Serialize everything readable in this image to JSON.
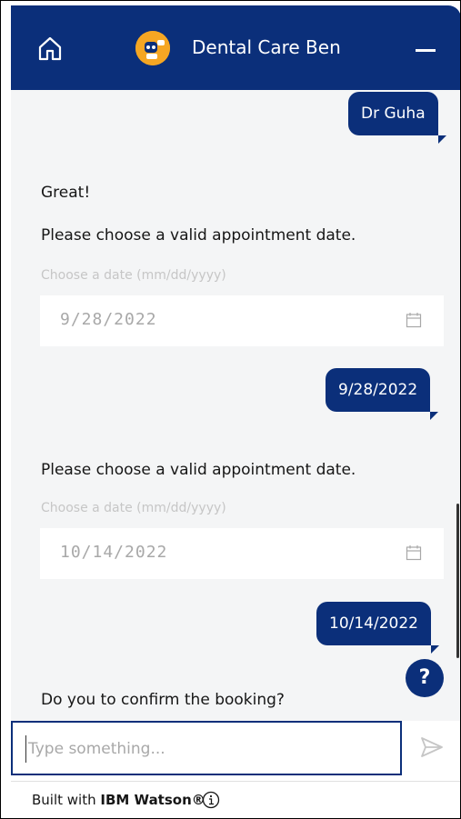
{
  "header": {
    "title": "Dental Care Ben"
  },
  "messages": {
    "user_1": "Dr Guha",
    "bot_1": "Great!",
    "bot_2": "Please choose a valid appointment date.",
    "date_label_1": "Choose a date (mm/dd/yyyy)",
    "date_value_1": "9/28/2022",
    "user_2": "9/28/2022",
    "bot_3": "Please choose a valid appointment date.",
    "date_label_2": "Choose a date (mm/dd/yyyy)",
    "date_value_2": "10/14/2022",
    "user_3": "10/14/2022",
    "bot_4": "Do you to confirm the booking?"
  },
  "help": {
    "label": "?"
  },
  "input": {
    "placeholder": "Type something..."
  },
  "footer": {
    "built_prefix": "Built with",
    "brand": "IBM Watson®"
  },
  "colors": {
    "brand": "#0b2f7a",
    "chat_bg": "#f4f5f6",
    "avatar": "#f5a623"
  }
}
